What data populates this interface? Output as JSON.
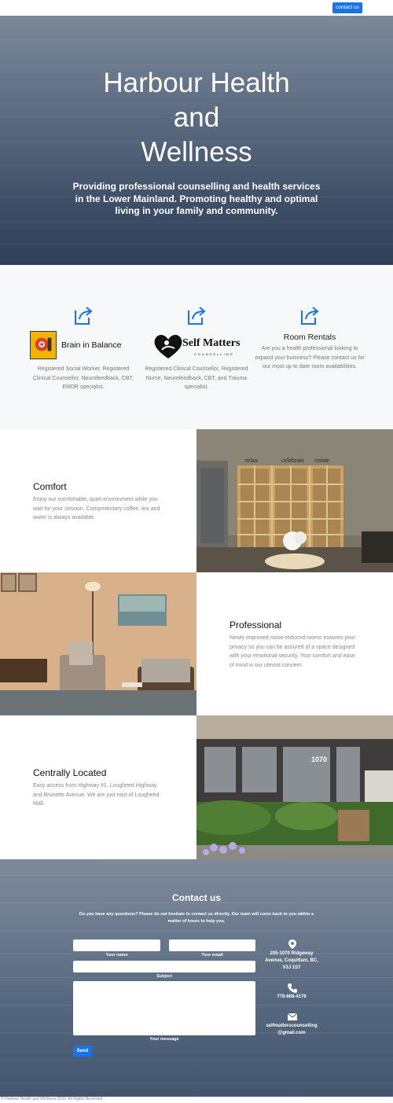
{
  "nav": {
    "contact_button": "contact us"
  },
  "hero": {
    "title_lines": [
      "Harbour Health",
      "and",
      "Wellness"
    ],
    "subtitle": "Providing professional counselling and health services in the Lower Mainland. Promoting healthy and optimal living in your family and community."
  },
  "services": [
    {
      "logo_text": "Brain in Balance",
      "description": "Registered Social Worker, Registered Clinical Counsellor, Neurofeedback, CBT, EMDR specialist."
    },
    {
      "logo_text": "Self Matters",
      "logo_sub": "COUNSELLING",
      "description": "Registered Clinical Counsellor, Registered Nurse, Neurofeedback, CBT, and Trauma specialist."
    },
    {
      "title": "Room Rentals",
      "description": "Are you a health professional looking to expand your buisness? Please contact us for our most up to date room availabilities."
    }
  ],
  "features": [
    {
      "title": "Comfort",
      "text": "Enjoy our comfortable, quiet environment while you wait for your session. Compmlentary coffee, tea and water is always available."
    },
    {
      "title": "Professional",
      "text": "Newly improved noise-reduced rooms ensures your privacy so you can be assured of a space designed with your emotional security. Your comfort and ease of mind is our utmost concern."
    },
    {
      "title": "Centrally Located",
      "text": "Easy access from Highway #1, Lougheed Highway and Brunette Avenue. We are just east of Lougheed Mall."
    }
  ],
  "photos": {
    "wall_words": [
      "relax",
      "celebrate",
      "create"
    ],
    "door_number": "1070"
  },
  "contact": {
    "title": "Contact us",
    "intro": "Do you have any questions? Please do not hesitate to contact us directly. Our team will come back to you within a matter of hours to help you.",
    "labels": {
      "name": "Your name",
      "email": "Your email",
      "subject": "Subject",
      "message": "Your message"
    },
    "send_label": "Send",
    "address": "205-1070 Ridgeway Avenue, Coquitlam, BC, V3J 1S7",
    "phone": "778-668-4176",
    "email": "selfmatterscounselling @gmail.com"
  },
  "footer": {
    "text": "© Harbour Health and Wellness 2020. All Rights Reserved."
  },
  "colors": {
    "accent": "#1a73e8",
    "hero_top": "#7b8898",
    "hero_bottom": "#2f3f57",
    "services_bg": "#f7f8fa"
  },
  "icons": [
    "external-link-icon",
    "map-marker-icon",
    "phone-icon",
    "envelope-icon"
  ]
}
